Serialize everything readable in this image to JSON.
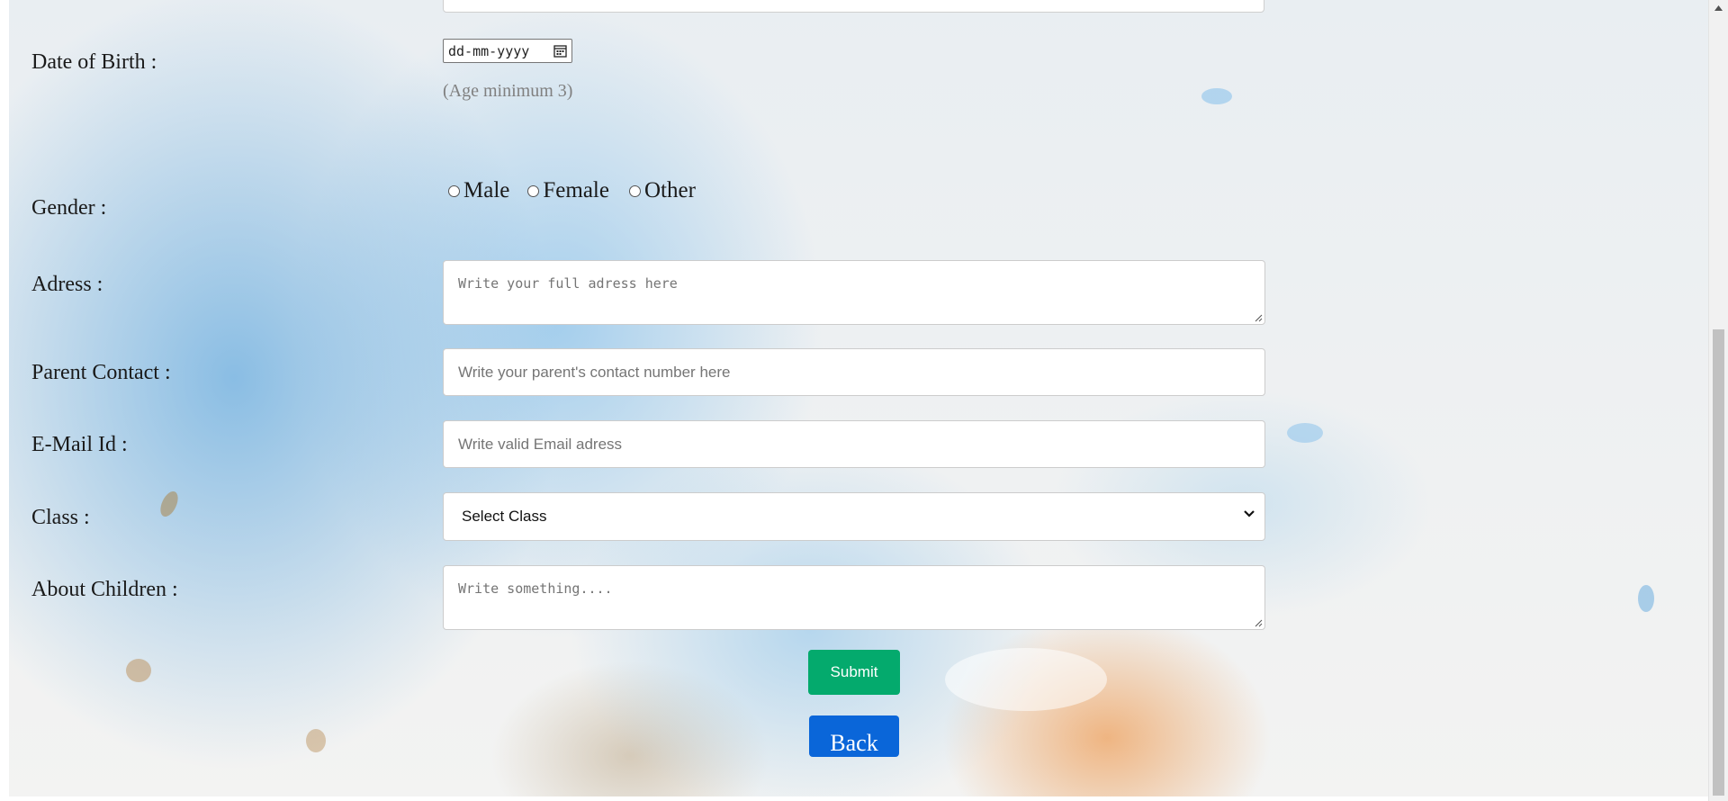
{
  "form": {
    "dob": {
      "label": "Date of Birth :",
      "placeholder": "dd-mm-yyyy",
      "note": "(Age minimum 3)",
      "icon": "calendar-icon"
    },
    "gender": {
      "label": "Gender :",
      "options": [
        "Male",
        "Female",
        "Other"
      ]
    },
    "address": {
      "label": "Adress :",
      "placeholder": "Write your full adress here"
    },
    "parent_contact": {
      "label": "Parent Contact :",
      "placeholder": "Write your parent's contact number here"
    },
    "email": {
      "label": "E-Mail Id :",
      "placeholder": "Write valid Email adress"
    },
    "class": {
      "label": "Class :",
      "selected": "Select Class",
      "icon": "chevron-down-icon"
    },
    "about": {
      "label": "About Children :",
      "placeholder": "Write something...."
    },
    "submit_label": "Submit",
    "back_label": "Back"
  },
  "colors": {
    "submit": "#04aa6d",
    "back": "#0a66d9",
    "label_text": "#1a1a1a",
    "placeholder": "#757575"
  }
}
